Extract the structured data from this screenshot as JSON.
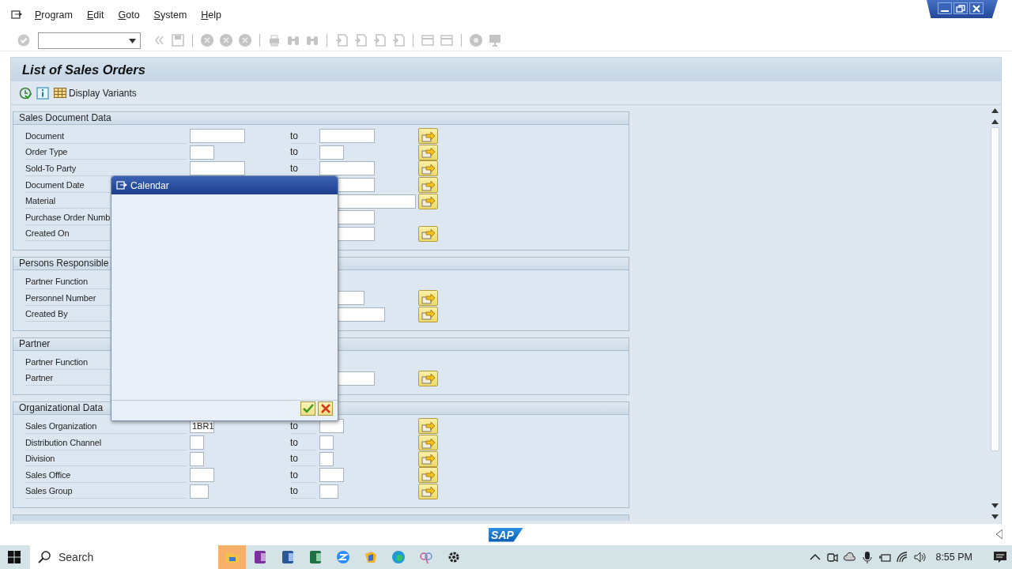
{
  "menu": [
    {
      "label": "Program"
    },
    {
      "label": "Edit"
    },
    {
      "label": "Goto"
    },
    {
      "label": "System"
    },
    {
      "label": "Help"
    }
  ],
  "title": "List of Sales Orders",
  "app_toolbar": {
    "variants_label": "Display Variants"
  },
  "sections": [
    {
      "title": "Sales Document Data",
      "rows": [
        {
          "label": "Document",
          "from_field": {
            "kind": "long"
          },
          "to_label": "to",
          "to_field": {
            "kind": "long"
          },
          "multiple_selection": true
        },
        {
          "label": "Order Type",
          "from_field": {
            "kind": "short"
          },
          "to_label": "to",
          "to_field": {
            "kind": "short"
          },
          "multiple_selection": true
        },
        {
          "label": "Sold-To Party",
          "from_field": {
            "kind": "long"
          },
          "to_label": "to",
          "to_field": {
            "kind": "long"
          },
          "multiple_selection": true
        },
        {
          "label": "Document Date",
          "to_field": {
            "kind": "long"
          },
          "multiple_selection": true
        },
        {
          "label": "Material",
          "to_field": {
            "kind": "widest"
          },
          "multiple_selection": true
        },
        {
          "label": "Purchase Order Numb",
          "to_field": {
            "kind": "long"
          },
          "multiple_selection": false
        },
        {
          "label": "Created On",
          "to_field": {
            "kind": "long"
          },
          "multiple_selection": true
        }
      ]
    },
    {
      "title": "Persons Responsible",
      "rows": [
        {
          "label": "Partner Function",
          "multiple_selection": false
        },
        {
          "label": "Personnel Number",
          "to_field": {
            "kind": "medium"
          },
          "multiple_selection": true
        },
        {
          "label": "Created By",
          "to_field": {
            "kind": "wider"
          },
          "multiple_selection": true
        }
      ]
    },
    {
      "title": "Partner",
      "rows": [
        {
          "label": "Partner Function",
          "multiple_selection": false
        },
        {
          "label": "Partner",
          "to_field": {
            "kind": "long"
          },
          "multiple_selection": true
        }
      ]
    },
    {
      "title": "Organizational Data",
      "rows": [
        {
          "label": "Sales Organization",
          "from_field": {
            "kind": "short",
            "value": "1BR1"
          },
          "to_label": "to",
          "to_field": {
            "kind": "short"
          },
          "multiple_selection": true
        },
        {
          "label": "Distribution Channel",
          "from_field": {
            "kind": "tiny"
          },
          "to_label": "to",
          "to_field": {
            "kind": "tiny"
          },
          "multiple_selection": true
        },
        {
          "label": "Division",
          "from_field": {
            "kind": "tiny"
          },
          "to_label": "to",
          "to_field": {
            "kind": "tiny"
          },
          "multiple_selection": true
        },
        {
          "label": "Sales Office",
          "from_field": {
            "kind": "short"
          },
          "to_label": "to",
          "to_field": {
            "kind": "short"
          },
          "multiple_selection": true
        },
        {
          "label": "Sales Group",
          "from_field": {
            "kind": "small"
          },
          "to_label": "to",
          "to_field": {
            "kind": "small"
          },
          "multiple_selection": true
        }
      ]
    }
  ],
  "popup": {
    "title": "Calendar"
  },
  "logo_text": "SAP",
  "taskbar": {
    "search_placeholder": "Search",
    "time": "8:55 PM"
  }
}
